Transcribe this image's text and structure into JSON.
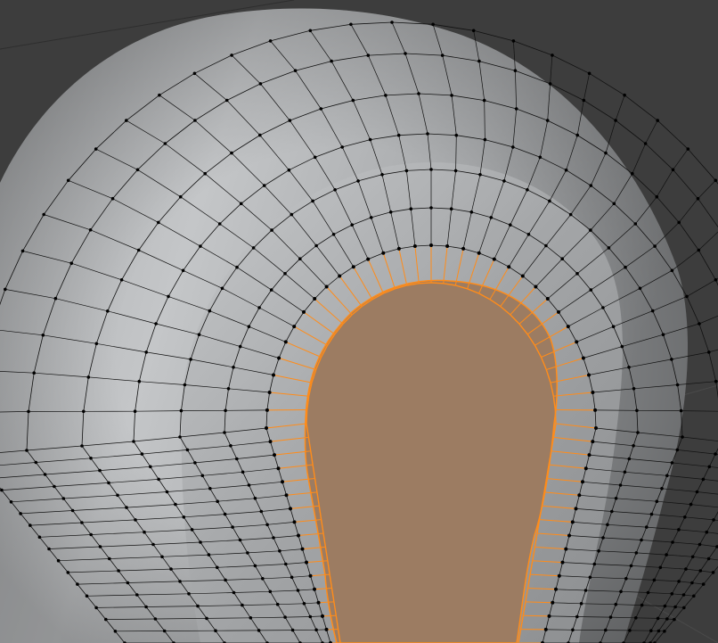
{
  "scene": {
    "mode": "edit-mode",
    "object": "mesh",
    "selection": "face",
    "colors": {
      "background": "#3d3d3d",
      "surface_light": "#c2c4c6",
      "surface_mid": "#9a9c9e",
      "surface_dark": "#6e7072",
      "selected_face": "#9c7c62",
      "selected_edge": "#ff8c1a",
      "edge": "#111111",
      "vertex": "#000000"
    }
  }
}
